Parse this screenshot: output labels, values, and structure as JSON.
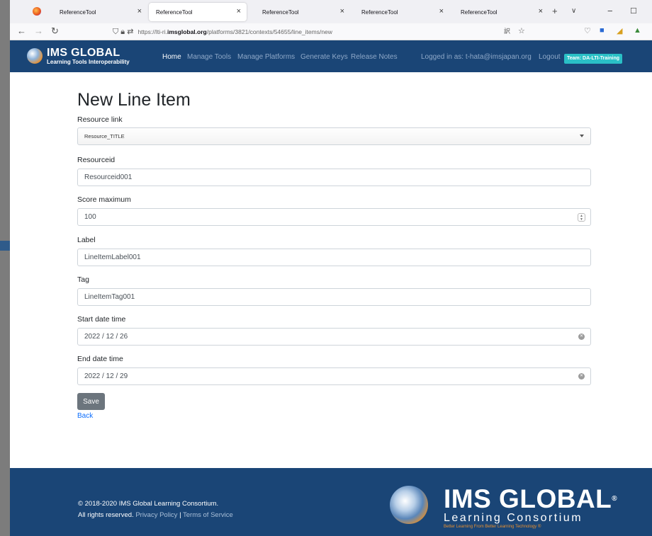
{
  "browser": {
    "tabs": [
      {
        "label": "ReferenceTool"
      },
      {
        "label": "ReferenceTool"
      },
      {
        "label": "ReferenceTool"
      },
      {
        "label": "ReferenceTool"
      },
      {
        "label": "ReferenceTool"
      }
    ],
    "url_prefix": "https://lti-ri.",
    "url_domain": "imsglobal.org",
    "url_path": "/platforms/3821/contexts/54655/line_items/new",
    "tab_close_glyph": "×",
    "new_tab_glyph": "+",
    "tab_list_glyph": "∨",
    "minimize_glyph": "−",
    "maximize_glyph": "☐"
  },
  "header": {
    "logo_main": "IMS GLOBAL",
    "logo_sub": "Learning Tools Interoperability",
    "nav": [
      "Home",
      "Manage Tools",
      "Manage Platforms",
      "Generate Keys",
      "Release Notes"
    ],
    "logged_in": "Logged in as: t-hata@imsjapan.org",
    "logout": "Logout",
    "team": "Team: DA-LTI-Training"
  },
  "form": {
    "title": "New Line Item",
    "resource_link_label": "Resource link",
    "resource_link_value": "Resource_TITLE",
    "resourceid_label": "Resourceid",
    "resourceid_value": "Resourceid001",
    "score_label": "Score maximum",
    "score_value": "100",
    "label_label": "Label",
    "label_value": "LineItemLabel001",
    "tag_label": "Tag",
    "tag_value": "LineItemTag001",
    "start_label": "Start date time",
    "start_value": "2022 / 12 / 26",
    "end_label": "End date time",
    "end_value": "2022 / 12 / 29",
    "save": "Save",
    "back": "Back"
  },
  "footer": {
    "copyright": "© 2018-2020 IMS Global Learning Consortium.",
    "rights": "All rights reserved.",
    "privacy": "Privacy Policy",
    "separator": "|",
    "terms": "Terms of Service",
    "brand_main": "IMS GLOBAL",
    "brand_reg": "®",
    "brand_sub": "Learning Consortium",
    "brand_tag": "Better Learning From Better Learning Technology ®"
  },
  "colors": {
    "header_bg": "#1a4576",
    "team_badge": "#2ac0c6",
    "save_button": "#6c757d",
    "link": "#0d6efd",
    "accent_orange": "#e89030"
  }
}
